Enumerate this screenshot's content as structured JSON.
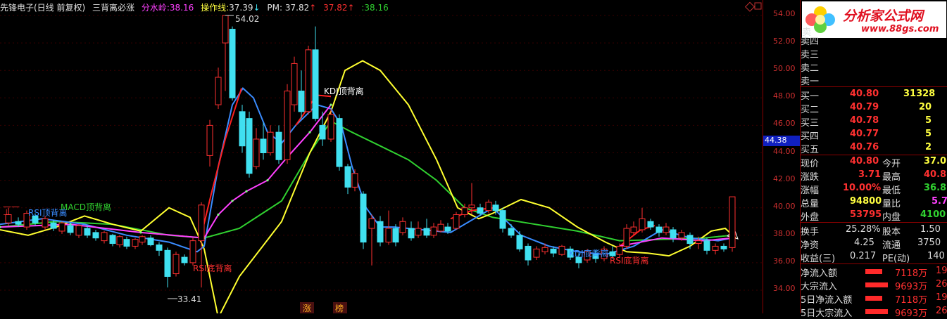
{
  "header": {
    "stock": "先锋电子(日线 前复权)",
    "formula": "三背离必涨",
    "fsl_label": "分水岭:",
    "fsl_value": "38.16",
    "czx_label": "操作线:",
    "czx_value": "37.39",
    "czx_arrow": "↓",
    "pm_label": "PM:",
    "pm_value": "37.82",
    "pm_red": "37.82",
    "up_arrow": "↑",
    "green_colon": ":",
    "green_value": "38.16"
  },
  "axis": {
    "ticks": [
      "54.00",
      "52.00",
      "50.00",
      "48.00",
      "46.00",
      "44.00",
      "42.00",
      "40.00",
      "38.00",
      "36.00",
      "34.00"
    ],
    "current": "44.38"
  },
  "annotations": {
    "high": "54.02",
    "low": "33.41",
    "kdj_top": "KDJ顶背离",
    "rsi_top": "RSI顶背离",
    "macd_top": "MACD顶背离",
    "rsi_bottom": "RSI底背离",
    "rsi_bottom2": "RSI底背离",
    "kdj_bottom": "KDJ底背离",
    "zhang": "涨",
    "bang": "榜"
  },
  "panel": {
    "logo_text": "分析家公式网",
    "logo_url": "www.88gs.com",
    "sell_partial": "卖",
    "sell": [
      "卖四",
      "卖三",
      "卖二",
      "卖一"
    ],
    "buy": [
      {
        "label": "买一",
        "price": "40.80",
        "vol": "31328"
      },
      {
        "label": "买二",
        "price": "40.79",
        "vol": "20"
      },
      {
        "label": "买三",
        "price": "40.78",
        "vol": "5"
      },
      {
        "label": "买四",
        "price": "40.77",
        "vol": "5"
      },
      {
        "label": "买五",
        "price": "40.76",
        "vol": "2"
      }
    ],
    "quote": [
      {
        "l1": "现价",
        "v1": "40.80",
        "l2": "今开",
        "v2": "37.0"
      },
      {
        "l1": "涨跌",
        "v1": "3.71",
        "l2": "最高",
        "v2": "40.8"
      },
      {
        "l1": "涨幅",
        "v1": "10.00%",
        "l2": "最低",
        "v2": "36.8"
      },
      {
        "l1": "总量",
        "v1": "94800",
        "l2": "量比",
        "v2": "5.7"
      },
      {
        "l1": "外盘",
        "v1": "53795",
        "l2": "内盘",
        "v2": "4100"
      }
    ],
    "stats": [
      {
        "l1": "换手",
        "v1": "25.28%",
        "l2": "股本",
        "v2": "1.50"
      },
      {
        "l1": "净资",
        "v1": "4.25",
        "l2": "流通",
        "v2": "3750"
      },
      {
        "l1": "收益(三)",
        "v1": "0.217",
        "l2": "PE(动)",
        "v2": "140"
      }
    ],
    "flows": [
      {
        "label": "净流入额",
        "value": "7118万",
        "extra": "19"
      },
      {
        "label": "大宗流入",
        "value": "9693万",
        "extra": "26"
      },
      {
        "label": "5日净流入额",
        "value": "7118万",
        "extra": "19"
      },
      {
        "label": "5日大宗流入",
        "value": "9693万",
        "extra": "26"
      }
    ]
  },
  "colors": {
    "up": "#ff3030",
    "down": "#40e0f0",
    "fsl": "#ff40ff",
    "czx": "#ffff40",
    "line_red": "#ff2020",
    "line_blue": "#3a8cff",
    "line_green": "#30d030",
    "line_yellow": "#ffff30"
  }
}
